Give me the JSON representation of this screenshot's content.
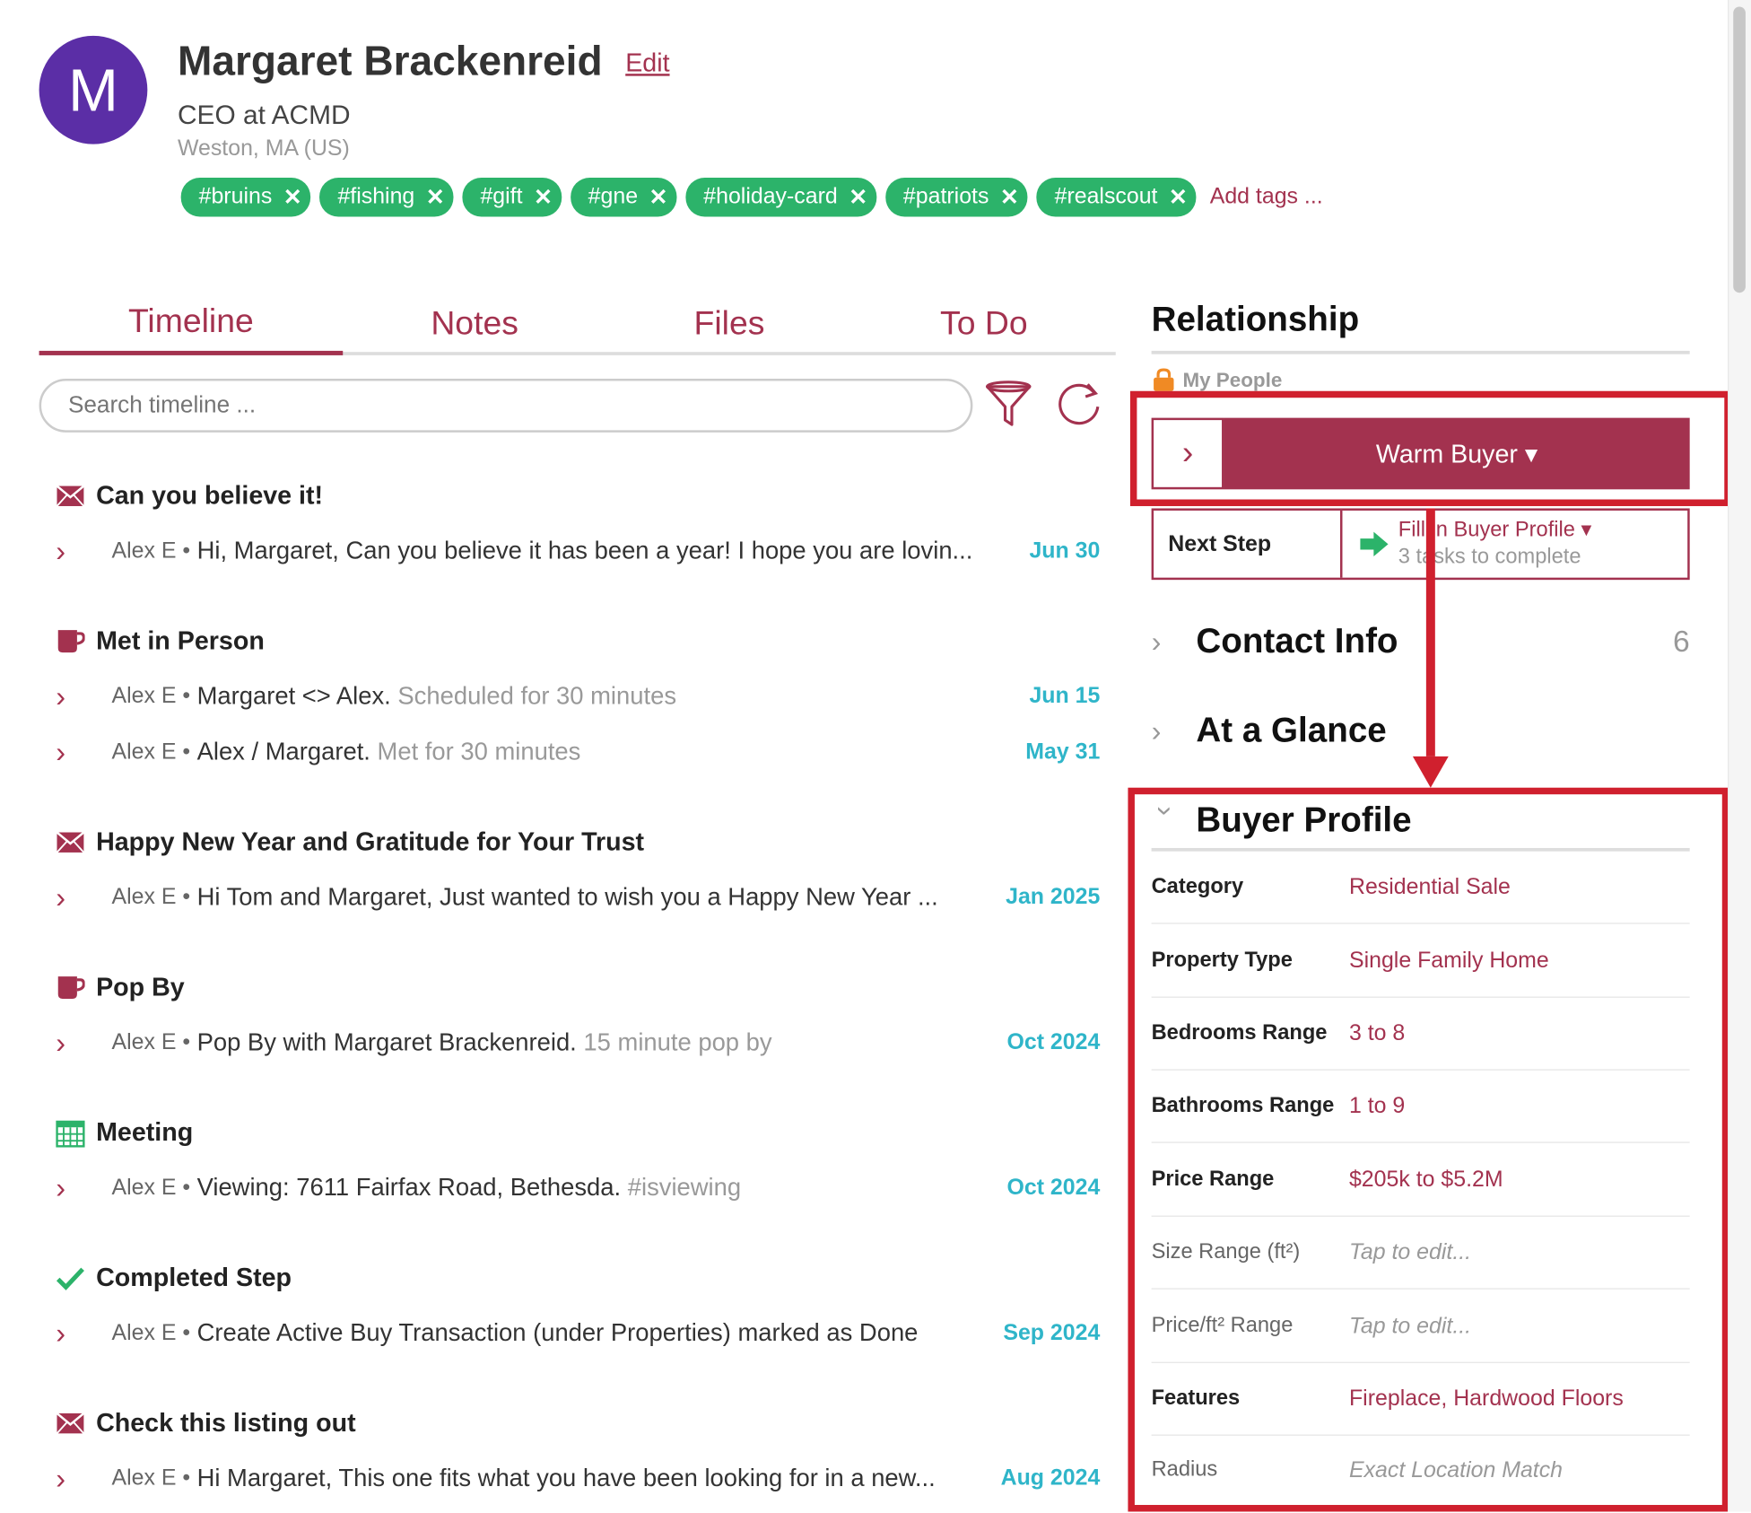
{
  "contact": {
    "initial": "M",
    "name": "Margaret Brackenreid",
    "edit_label": "Edit",
    "title": "CEO at ACMD",
    "location": "Weston, MA (US)",
    "avatar_color": "#5b2ea6"
  },
  "tags": [
    "#bruins",
    "#fishing",
    "#gift",
    "#gne",
    "#holiday-card",
    "#patriots",
    "#realscout"
  ],
  "add_tags_label": "Add tags ...",
  "tabs": [
    "Timeline",
    "Notes",
    "Files",
    "To Do"
  ],
  "search": {
    "placeholder": "Search timeline ..."
  },
  "timeline": [
    {
      "heading": "Can you believe it!",
      "icon": "envelope-icon",
      "entries": [
        {
          "author": "Alex E •",
          "text": "Hi, Margaret, Can you believe it has been a year! I hope you are lovin...",
          "muted": "",
          "date": "Jun 30"
        }
      ]
    },
    {
      "heading": "Met in Person",
      "icon": "mug-icon",
      "entries": [
        {
          "author": "Alex E •",
          "text": "Margaret <> Alex.",
          "muted": "Scheduled for 30 minutes",
          "date": "Jun 15"
        },
        {
          "author": "Alex E •",
          "text": "Alex / Margaret.",
          "muted": "Met for 30 minutes",
          "date": "May 31"
        }
      ]
    },
    {
      "heading": "Happy New Year and Gratitude for Your Trust",
      "icon": "envelope-icon",
      "entries": [
        {
          "author": "Alex E •",
          "text": "Hi Tom and Margaret, Just wanted to wish you a Happy New Year ...",
          "muted": "",
          "date": "Jan 2025"
        }
      ]
    },
    {
      "heading": "Pop By",
      "icon": "mug-icon",
      "entries": [
        {
          "author": "Alex E •",
          "text": "Pop By with Margaret Brackenreid.",
          "muted": "15 minute pop by",
          "date": "Oct 2024"
        }
      ]
    },
    {
      "heading": "Meeting",
      "icon": "calendar-icon",
      "entries": [
        {
          "author": "Alex E •",
          "text": "Viewing: 7611 Fairfax Road, Bethesda.",
          "muted": "#isviewing",
          "date": "Oct 2024"
        }
      ]
    },
    {
      "heading": "Completed Step",
      "icon": "checkmark-icon",
      "entries": [
        {
          "author": "Alex E •",
          "text": "Create Active Buy Transaction (under Properties) marked as Done",
          "muted": "",
          "date": "Sep 2024"
        }
      ]
    },
    {
      "heading": "Check this listing out",
      "icon": "envelope-icon",
      "entries": [
        {
          "author": "Alex E •",
          "text": "Hi Margaret, This one fits what you have been looking for in a new...",
          "muted": "",
          "date": "Aug 2024"
        }
      ]
    }
  ],
  "relationship": {
    "title": "Relationship",
    "group": "My People",
    "stage": "Warm Buyer ▾",
    "next_step_label": "Next Step",
    "next_step_value": "Fill in Buyer Profile ▾",
    "next_step_sub": "3 tasks to complete"
  },
  "sections": {
    "contact_info": {
      "label": "Contact Info",
      "count": "6"
    },
    "at_a_glance": {
      "label": "At a Glance"
    },
    "buyer_profile": {
      "label": "Buyer Profile"
    }
  },
  "buyer_profile": [
    {
      "key": "Category",
      "value": "Residential Sale",
      "placeholder": false,
      "bold": true
    },
    {
      "key": "Property Type",
      "value": "Single Family Home",
      "placeholder": false,
      "bold": true
    },
    {
      "key": "Bedrooms Range",
      "value": "3 to 8",
      "placeholder": false,
      "bold": true
    },
    {
      "key": "Bathrooms Range",
      "value": "1 to 9",
      "placeholder": false,
      "bold": true
    },
    {
      "key": "Price Range",
      "value": "$205k to $5.2M",
      "placeholder": false,
      "bold": true
    },
    {
      "key": "Size Range (ft²)",
      "value": "Tap to edit...",
      "placeholder": true,
      "bold": false
    },
    {
      "key": "Price/ft² Range",
      "value": "Tap to edit...",
      "placeholder": true,
      "bold": false
    },
    {
      "key": "Features",
      "value": "Fireplace, Hardwood Floors",
      "placeholder": false,
      "bold": true
    },
    {
      "key": "Radius",
      "value": "Exact Location Match",
      "placeholder": true,
      "bold": false
    }
  ],
  "colors": {
    "accent": "#a3324f",
    "tag_green": "#2cb36a",
    "date_teal": "#2fb5c9",
    "annotation_red": "#d0202e"
  }
}
